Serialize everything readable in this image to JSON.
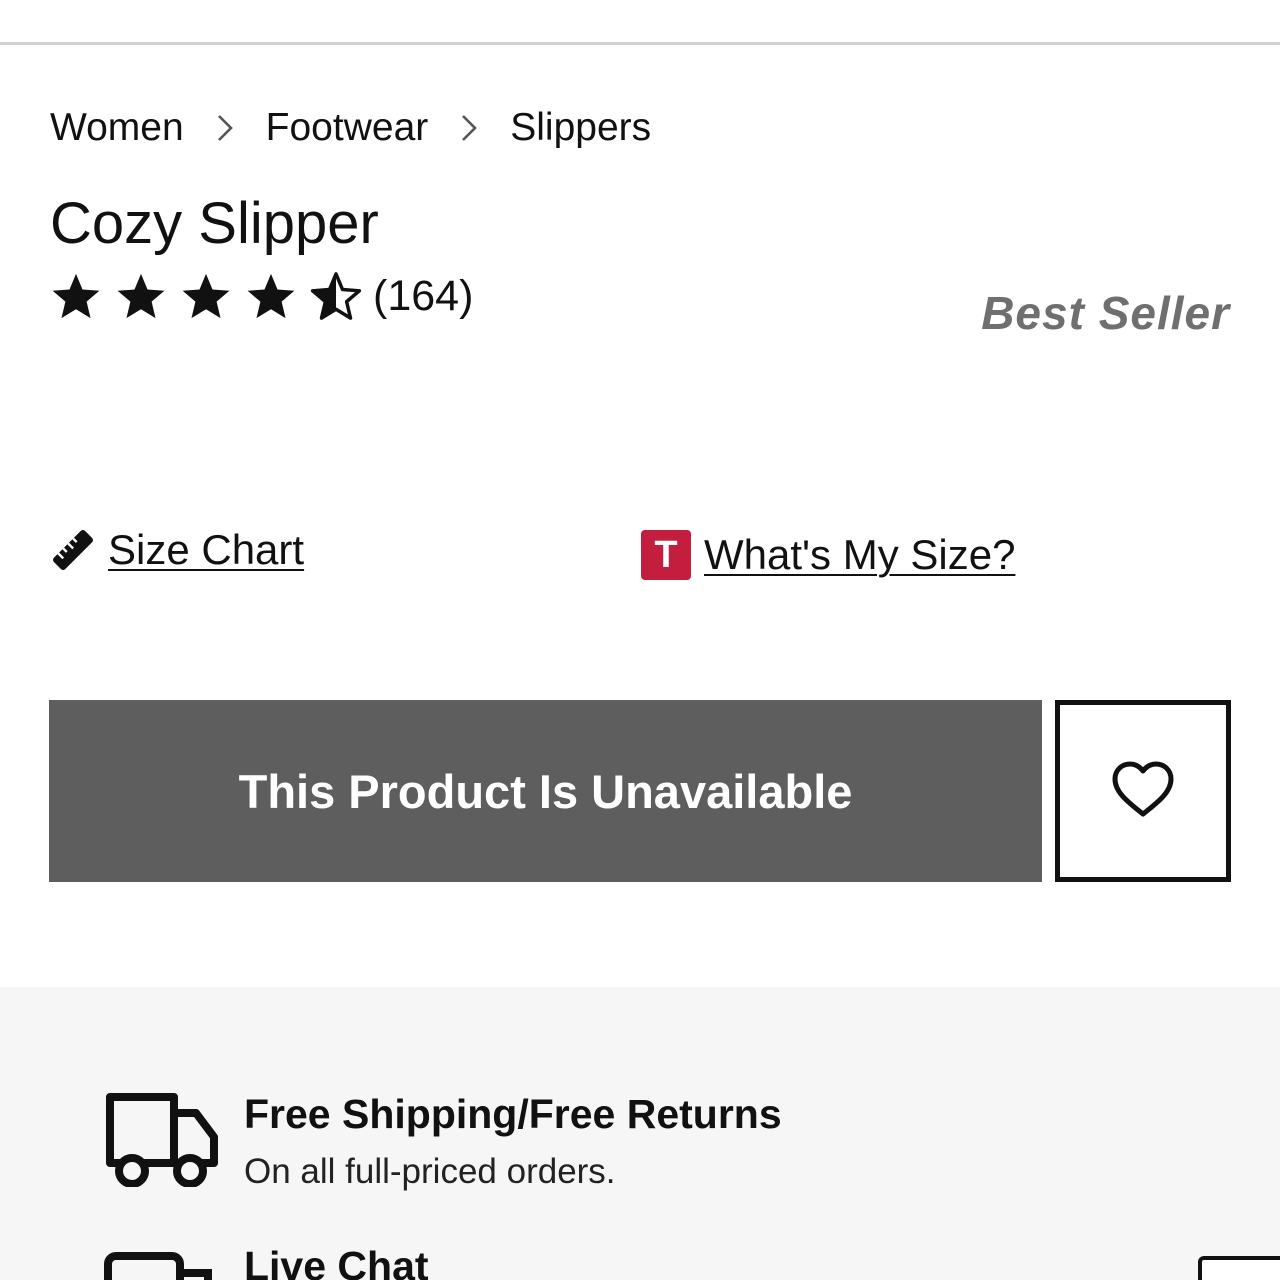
{
  "breadcrumb": {
    "items": [
      "Women",
      "Footwear",
      "Slippers"
    ]
  },
  "product": {
    "title": "Cozy Slipper",
    "rating_value": 4.5,
    "rating_max": 5,
    "rating_count": "(164)",
    "badge": "Best Seller"
  },
  "links": {
    "size_chart": "Size Chart",
    "whats_my_size": "What's My Size?",
    "t_icon_letter": "T"
  },
  "actions": {
    "unavailable_label": "This Product Is Unavailable"
  },
  "benefits": [
    {
      "title": "Free Shipping/Free Returns",
      "subtitle": "On all full-priced orders.",
      "icon": "truck-icon"
    },
    {
      "title": "Live Chat",
      "subtitle": "",
      "icon": "chat-icon"
    }
  ],
  "colors": {
    "button_disabled": "#5e5e5e",
    "badge_text": "#6f6f6f",
    "t_icon_bg": "#c41e3f",
    "benefits_bg": "#f6f6f6"
  }
}
